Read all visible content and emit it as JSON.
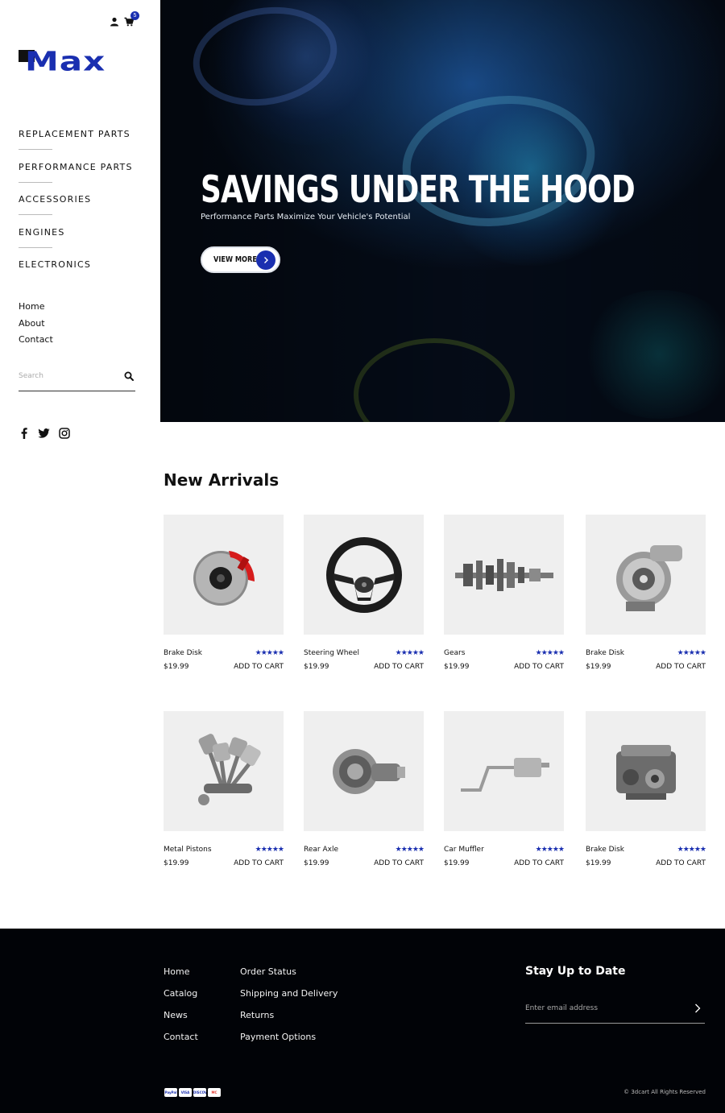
{
  "header": {
    "cart_count": "5",
    "logo_text": "Max"
  },
  "sidebar": {
    "main_nav": [
      {
        "label": "REPLACEMENT PARTS"
      },
      {
        "label": "PERFORMANCE PARTS"
      },
      {
        "label": "ACCESSORIES"
      },
      {
        "label": "ENGINES"
      },
      {
        "label": "ELECTRONICS"
      }
    ],
    "sub_nav": [
      {
        "label": "Home"
      },
      {
        "label": "About"
      },
      {
        "label": "Contact"
      }
    ],
    "search": {
      "placeholder": "Search"
    },
    "social_icons": [
      "facebook-icon",
      "twitter-icon",
      "instagram-icon"
    ]
  },
  "hero": {
    "title": "SAVINGS UNDER THE HOOD",
    "subtitle": "Performance Parts Maximize Your Vehicle's Potential",
    "button_label": "VIEW MORE"
  },
  "new_arrivals": {
    "title": "New Arrivals",
    "rating_stars": "★★★★★",
    "add_to_cart_label": "ADD TO CART",
    "products": [
      {
        "name": "Brake Disk",
        "price": "$19.99",
        "image": "brake-disk"
      },
      {
        "name": "Steering Wheel",
        "price": "$19.99",
        "image": "steering-wheel"
      },
      {
        "name": "Gears",
        "price": "$19.99",
        "image": "gears"
      },
      {
        "name": "Brake Disk",
        "price": "$19.99",
        "image": "turbo"
      },
      {
        "name": "Metal Pistons",
        "price": "$19.99",
        "image": "pistons"
      },
      {
        "name": "Rear Axle",
        "price": "$19.99",
        "image": "axle"
      },
      {
        "name": "Car Muffler",
        "price": "$19.99",
        "image": "muffler"
      },
      {
        "name": "Brake Disk",
        "price": "$19.99",
        "image": "engine"
      }
    ]
  },
  "footer": {
    "col1": [
      {
        "label": "Home"
      },
      {
        "label": "Catalog"
      },
      {
        "label": "News"
      },
      {
        "label": "Contact"
      }
    ],
    "col2": [
      {
        "label": "Order Status"
      },
      {
        "label": "Shipping and Delivery"
      },
      {
        "label": "Returns"
      },
      {
        "label": "Payment Options"
      }
    ],
    "newsletter_title": "Stay Up to Date",
    "email_placeholder": "Enter email address",
    "payment_cards": [
      "PayPal",
      "VISA",
      "DISCOVER",
      "MC"
    ],
    "copyright": "© 3dcart All Rights Reserved"
  },
  "colors": {
    "accent": "#1a2fb0",
    "footer_bg": "#010307",
    "product_bg": "#efefef"
  }
}
